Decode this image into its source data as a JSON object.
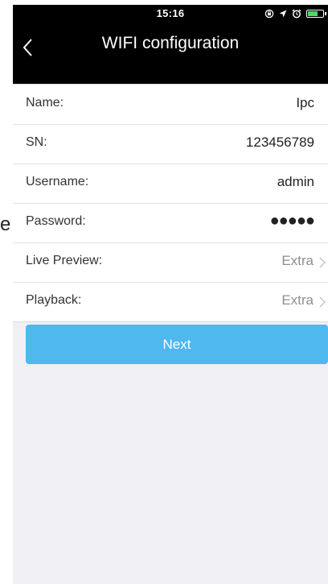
{
  "status_bar": {
    "time": "15:16",
    "icons": [
      "lock-rotation-icon",
      "location-icon",
      "alarm-icon",
      "battery-icon"
    ],
    "battery_color": "#4cd964"
  },
  "nav": {
    "title": "WIFI configuration",
    "back_icon": "chevron-left-icon"
  },
  "form": {
    "rows": [
      {
        "label": "Name:",
        "value": "Ipc"
      },
      {
        "label": "SN:",
        "value": "123456789"
      },
      {
        "label": "Username:",
        "value": "admin"
      },
      {
        "label": "Password:",
        "value": "●●●●●"
      },
      {
        "label": "Live Preview:",
        "value": "Extra",
        "chevron_icon": "chevron-right-icon"
      },
      {
        "label": "Playback:",
        "value": "Extra",
        "chevron_icon": "chevron-right-icon"
      }
    ]
  },
  "next_button": {
    "label": "Next",
    "color": "#4fb8ee"
  },
  "background_page": {
    "visible_glyph": "e"
  }
}
